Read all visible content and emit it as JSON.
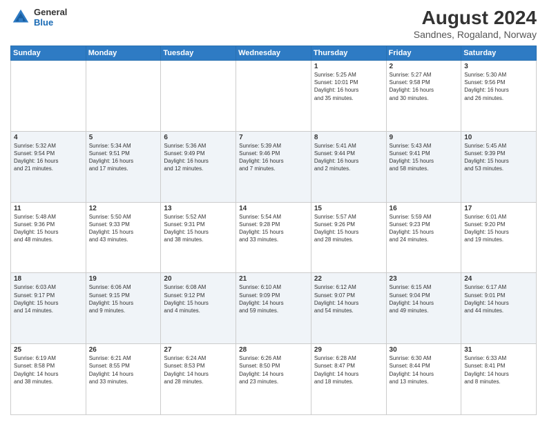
{
  "header": {
    "logo": {
      "general": "General",
      "blue": "Blue"
    },
    "title": "August 2024",
    "location": "Sandnes, Rogaland, Norway"
  },
  "days_of_week": [
    "Sunday",
    "Monday",
    "Tuesday",
    "Wednesday",
    "Thursday",
    "Friday",
    "Saturday"
  ],
  "weeks": [
    [
      {
        "day": "",
        "info": ""
      },
      {
        "day": "",
        "info": ""
      },
      {
        "day": "",
        "info": ""
      },
      {
        "day": "",
        "info": ""
      },
      {
        "day": "1",
        "info": "Sunrise: 5:25 AM\nSunset: 10:01 PM\nDaylight: 16 hours\nand 35 minutes."
      },
      {
        "day": "2",
        "info": "Sunrise: 5:27 AM\nSunset: 9:58 PM\nDaylight: 16 hours\nand 30 minutes."
      },
      {
        "day": "3",
        "info": "Sunrise: 5:30 AM\nSunset: 9:56 PM\nDaylight: 16 hours\nand 26 minutes."
      }
    ],
    [
      {
        "day": "4",
        "info": "Sunrise: 5:32 AM\nSunset: 9:54 PM\nDaylight: 16 hours\nand 21 minutes."
      },
      {
        "day": "5",
        "info": "Sunrise: 5:34 AM\nSunset: 9:51 PM\nDaylight: 16 hours\nand 17 minutes."
      },
      {
        "day": "6",
        "info": "Sunrise: 5:36 AM\nSunset: 9:49 PM\nDaylight: 16 hours\nand 12 minutes."
      },
      {
        "day": "7",
        "info": "Sunrise: 5:39 AM\nSunset: 9:46 PM\nDaylight: 16 hours\nand 7 minutes."
      },
      {
        "day": "8",
        "info": "Sunrise: 5:41 AM\nSunset: 9:44 PM\nDaylight: 16 hours\nand 2 minutes."
      },
      {
        "day": "9",
        "info": "Sunrise: 5:43 AM\nSunset: 9:41 PM\nDaylight: 15 hours\nand 58 minutes."
      },
      {
        "day": "10",
        "info": "Sunrise: 5:45 AM\nSunset: 9:39 PM\nDaylight: 15 hours\nand 53 minutes."
      }
    ],
    [
      {
        "day": "11",
        "info": "Sunrise: 5:48 AM\nSunset: 9:36 PM\nDaylight: 15 hours\nand 48 minutes."
      },
      {
        "day": "12",
        "info": "Sunrise: 5:50 AM\nSunset: 9:33 PM\nDaylight: 15 hours\nand 43 minutes."
      },
      {
        "day": "13",
        "info": "Sunrise: 5:52 AM\nSunset: 9:31 PM\nDaylight: 15 hours\nand 38 minutes."
      },
      {
        "day": "14",
        "info": "Sunrise: 5:54 AM\nSunset: 9:28 PM\nDaylight: 15 hours\nand 33 minutes."
      },
      {
        "day": "15",
        "info": "Sunrise: 5:57 AM\nSunset: 9:26 PM\nDaylight: 15 hours\nand 28 minutes."
      },
      {
        "day": "16",
        "info": "Sunrise: 5:59 AM\nSunset: 9:23 PM\nDaylight: 15 hours\nand 24 minutes."
      },
      {
        "day": "17",
        "info": "Sunrise: 6:01 AM\nSunset: 9:20 PM\nDaylight: 15 hours\nand 19 minutes."
      }
    ],
    [
      {
        "day": "18",
        "info": "Sunrise: 6:03 AM\nSunset: 9:17 PM\nDaylight: 15 hours\nand 14 minutes."
      },
      {
        "day": "19",
        "info": "Sunrise: 6:06 AM\nSunset: 9:15 PM\nDaylight: 15 hours\nand 9 minutes."
      },
      {
        "day": "20",
        "info": "Sunrise: 6:08 AM\nSunset: 9:12 PM\nDaylight: 15 hours\nand 4 minutes."
      },
      {
        "day": "21",
        "info": "Sunrise: 6:10 AM\nSunset: 9:09 PM\nDaylight: 14 hours\nand 59 minutes."
      },
      {
        "day": "22",
        "info": "Sunrise: 6:12 AM\nSunset: 9:07 PM\nDaylight: 14 hours\nand 54 minutes."
      },
      {
        "day": "23",
        "info": "Sunrise: 6:15 AM\nSunset: 9:04 PM\nDaylight: 14 hours\nand 49 minutes."
      },
      {
        "day": "24",
        "info": "Sunrise: 6:17 AM\nSunset: 9:01 PM\nDaylight: 14 hours\nand 44 minutes."
      }
    ],
    [
      {
        "day": "25",
        "info": "Sunrise: 6:19 AM\nSunset: 8:58 PM\nDaylight: 14 hours\nand 38 minutes."
      },
      {
        "day": "26",
        "info": "Sunrise: 6:21 AM\nSunset: 8:55 PM\nDaylight: 14 hours\nand 33 minutes."
      },
      {
        "day": "27",
        "info": "Sunrise: 6:24 AM\nSunset: 8:53 PM\nDaylight: 14 hours\nand 28 minutes."
      },
      {
        "day": "28",
        "info": "Sunrise: 6:26 AM\nSunset: 8:50 PM\nDaylight: 14 hours\nand 23 minutes."
      },
      {
        "day": "29",
        "info": "Sunrise: 6:28 AM\nSunset: 8:47 PM\nDaylight: 14 hours\nand 18 minutes."
      },
      {
        "day": "30",
        "info": "Sunrise: 6:30 AM\nSunset: 8:44 PM\nDaylight: 14 hours\nand 13 minutes."
      },
      {
        "day": "31",
        "info": "Sunrise: 6:33 AM\nSunset: 8:41 PM\nDaylight: 14 hours\nand 8 minutes."
      }
    ]
  ]
}
